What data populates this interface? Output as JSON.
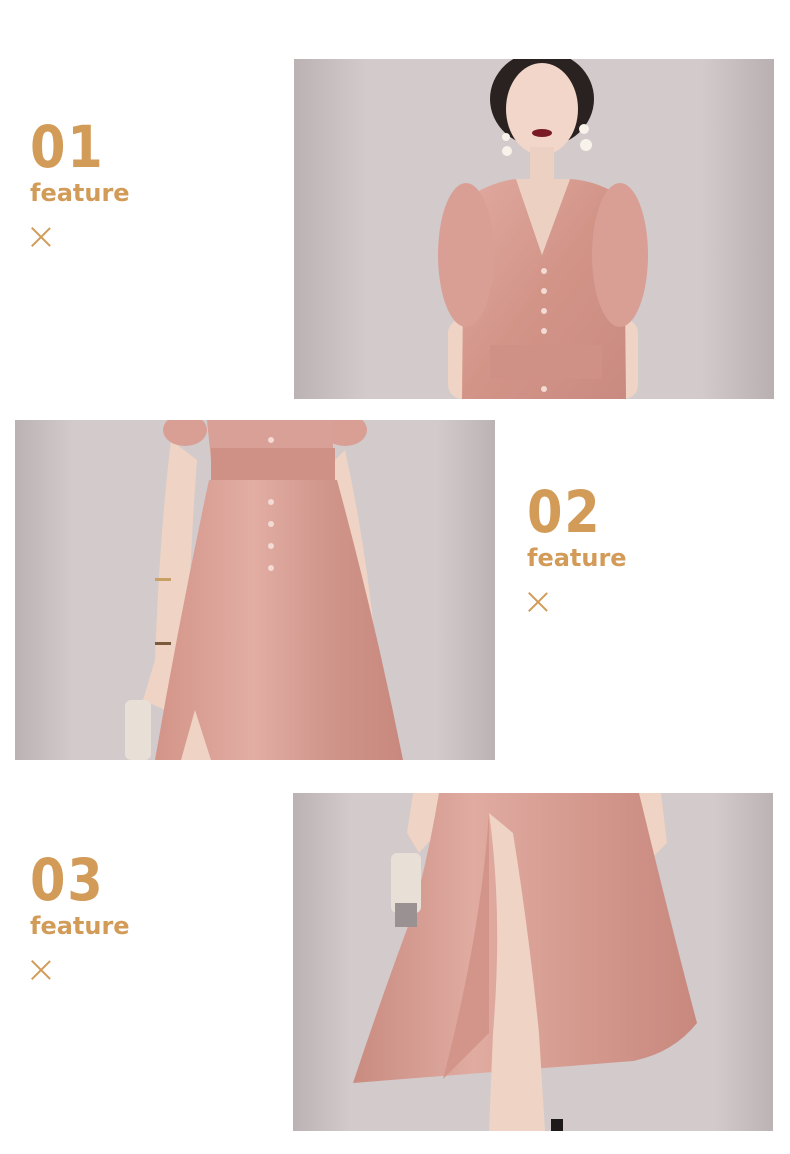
{
  "features": [
    {
      "number": "01",
      "label": "feature",
      "icon": "close-icon"
    },
    {
      "number": "02",
      "label": "feature",
      "icon": "close-icon"
    },
    {
      "number": "03",
      "label": "feature",
      "icon": "close-icon"
    }
  ],
  "colors": {
    "accent": "#d29b58",
    "backdrop": "#cbc2c3",
    "dress": "#d89c93",
    "skin": "#efd3c4"
  }
}
